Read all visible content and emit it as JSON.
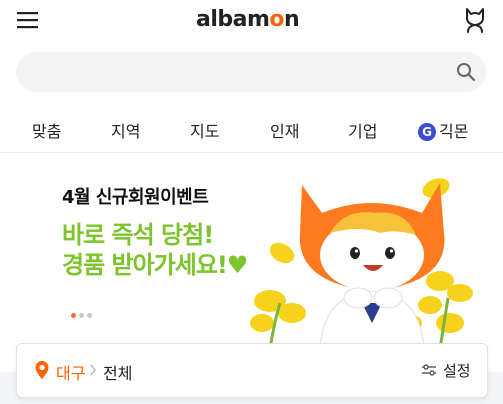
{
  "header": {
    "logo_main": "albam",
    "logo_o": "o",
    "logo_end": "n"
  },
  "search": {
    "placeholder": "",
    "value": ""
  },
  "nav": {
    "tabs": [
      {
        "label": "맞춤"
      },
      {
        "label": "지역"
      },
      {
        "label": "지도"
      },
      {
        "label": "인재"
      },
      {
        "label": "기업"
      },
      {
        "label": "긱몬",
        "badge": "G"
      }
    ]
  },
  "banner": {
    "subtitle": "4월 신규회원이벤트",
    "headline_line1": "바로 즉석 당첨!",
    "headline_line2": "경품 받아가세요!♥",
    "slide_index": 1,
    "slide_count": 3
  },
  "location": {
    "city": "대구",
    "area": "전체",
    "settings_label": "설정"
  },
  "colors": {
    "brand": "#ff6200",
    "headline_green": "#7bc42a",
    "g_badge": "#3b4cd6"
  }
}
